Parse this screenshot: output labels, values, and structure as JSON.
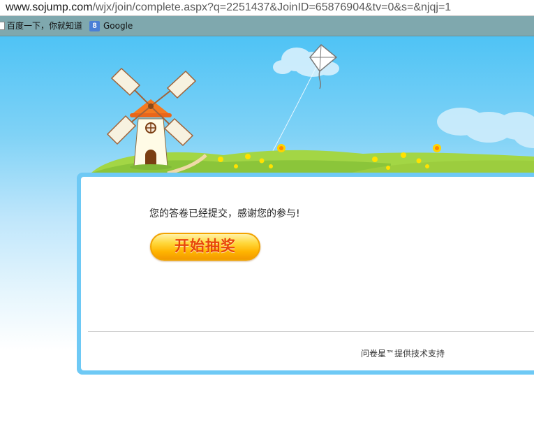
{
  "browser": {
    "url_host": "www.sojump.com",
    "url_path": "/wjx/join/complete.aspx?q=2251437&JoinID=65876904&tv=0&s=&njqj=1",
    "bookmarks": [
      {
        "label": "百度一下，你就知道",
        "icon": "page-icon"
      },
      {
        "label": "Google",
        "icon": "google-icon",
        "icon_text": "8"
      }
    ]
  },
  "main": {
    "thanks_message": "您的答卷已经提交，感谢您的参与!",
    "lottery_button": "开始抽奖",
    "footer_text": "问卷星™提供技术支持"
  },
  "colors": {
    "sky": "#4fc3f5",
    "card_border": "#6ec9f5",
    "button_text": "#e8460a",
    "button_fill": "#ffc21a"
  }
}
